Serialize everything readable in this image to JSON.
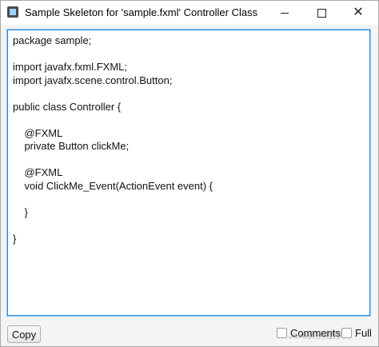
{
  "window": {
    "title": "Sample Skeleton for 'sample.fxml' Controller Class",
    "minimize_icon": "minimize-icon",
    "maximize_icon": "maximize-icon",
    "close_icon": "close-icon",
    "close_glyph": "✕"
  },
  "editor": {
    "code": "package sample;\n\nimport javafx.fxml.FXML;\nimport javafx.scene.control.Button;\n\npublic class Controller {\n\n    @FXML\n    private Button clickMe;\n\n    @FXML\n    void ClickMe_Event(ActionEvent event) {\n\n    }\n\n}"
  },
  "footer": {
    "copy_label": "Copy",
    "comments_label": "Comments",
    "full_label": "Full",
    "comments_checked": false,
    "full_checked": false,
    "watermark": "Java实例程序"
  },
  "colors": {
    "focus_border": "#2b8ce2",
    "window_bg": "#f0f0f0"
  }
}
